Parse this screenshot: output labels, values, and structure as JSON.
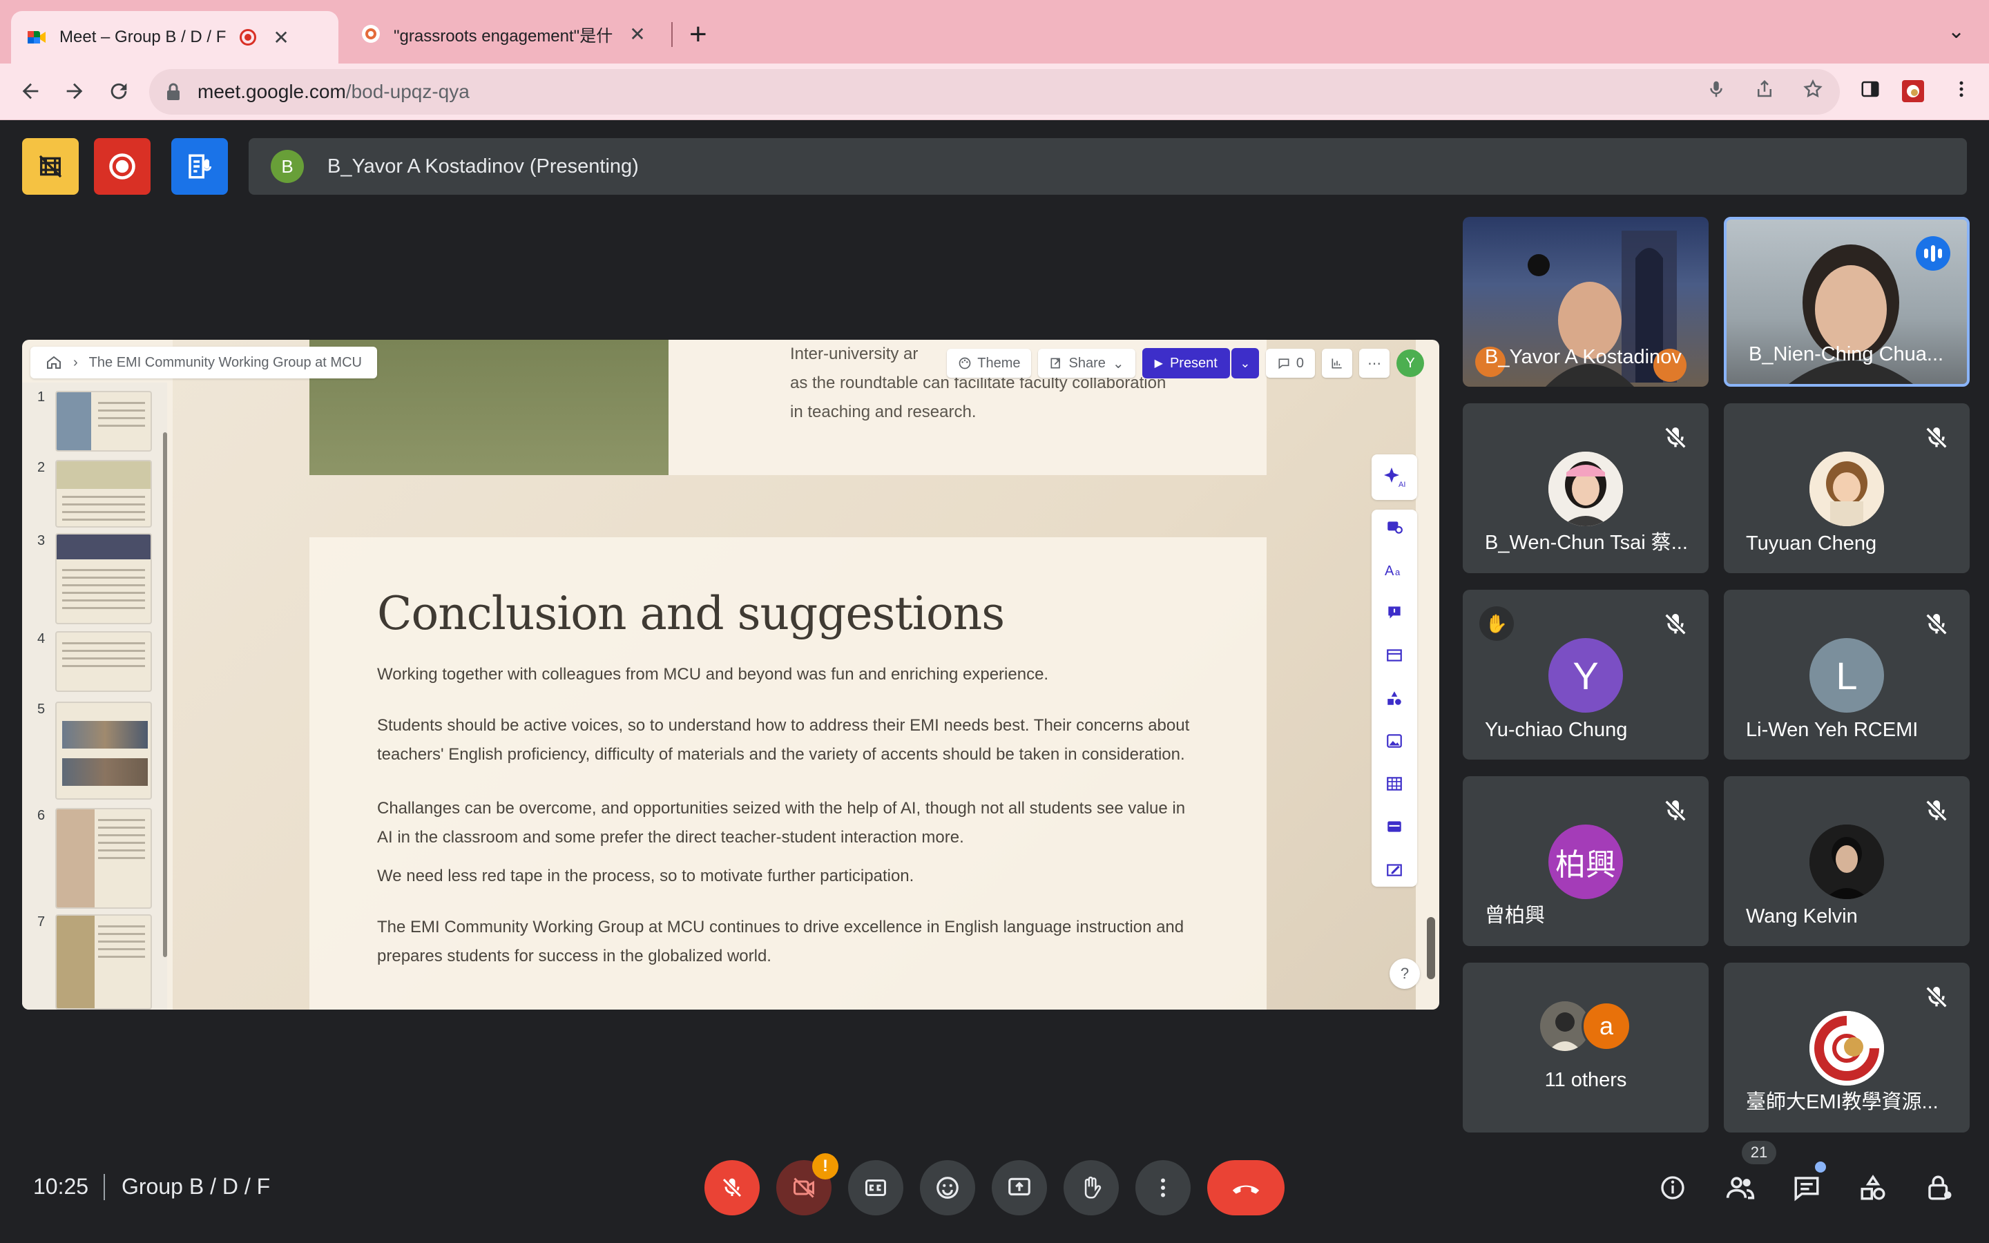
{
  "browser": {
    "tabs": [
      {
        "title": "Meet – Group B / D / F",
        "recording": true
      },
      {
        "title": "\"grassroots engagement\"是什"
      }
    ],
    "url_host": "meet.google.com",
    "url_path": "/bod-upqz-qya"
  },
  "meet": {
    "presenter_initial": "B",
    "presenting_label": "B_Yavor A Kostadinov (Presenting)",
    "time": "10:25",
    "meeting_name": "Group B / D / F",
    "people_count": "21",
    "warning_badge": "!"
  },
  "slides_editor": {
    "breadcrumb_title": "The EMI Community Working Group at MCU",
    "theme_label": "Theme",
    "share_label": "Share",
    "present_label": "Present",
    "comment_count": "0",
    "user_initial": "Y",
    "ai_label": "AI",
    "help_label": "?",
    "thumbnail_numbers": [
      "1",
      "2",
      "3",
      "4",
      "5",
      "6",
      "7"
    ]
  },
  "slide": {
    "top_text": "Inter-university ar… as the roundtable can facilitate faculty collaboration in teaching and research.",
    "top_line1": "Inter-university ar",
    "top_line2": "as the roundtable can facilitate faculty collaboration",
    "top_line3": "in teaching and research.",
    "title": "Conclusion and suggestions",
    "paragraphs": [
      "Working together with colleagues from MCU and beyond was fun and enriching experience.",
      "Students should be active voices, so to understand how to address their EMI needs best. Their concerns about teachers' English proficiency, difficulty of materials and the variety of accents should be taken in consideration.",
      "Challanges can be overcome, and opportunities seized with the help of AI, though not all students see value in AI in the classroom and some prefer the direct teacher-student interaction more.",
      "We need less red tape in the process, so to motivate further participation.",
      "The EMI Community Working Group at MCU continues to drive excellence in English language instruction and prepares students for success in the globalized world."
    ]
  },
  "participants": [
    {
      "name": "B_Yavor A Kostadinov",
      "kind": "video"
    },
    {
      "name": "B_Nien-Ching Chua...",
      "kind": "video",
      "speaking": true
    },
    {
      "name": "B_Wen-Chun Tsai 蔡...",
      "kind": "photo",
      "muted": true
    },
    {
      "name": "Tuyuan Cheng",
      "kind": "photo",
      "muted": true
    },
    {
      "name": "Yu-chiao Chung",
      "initial": "Y",
      "color": "#7b4fc4",
      "muted": true,
      "hand_raised": true
    },
    {
      "name": "Li-Wen Yeh RCEMI",
      "initial": "L",
      "color": "#7b8f9c",
      "muted": true
    },
    {
      "name": "曾柏興",
      "initial": "柏興",
      "color": "#a43cb8",
      "muted": true
    },
    {
      "name": "Wang Kelvin",
      "kind": "photo",
      "muted": true
    },
    {
      "name": "11 others",
      "initial": "a",
      "color": "#e8710a"
    },
    {
      "name": "臺師大EMI教學資源...",
      "kind": "logo",
      "muted": true
    }
  ],
  "colors": {
    "present_button": "#3d2ec9",
    "hangup": "#ea4335",
    "speaking_indicator": "#1a73e8"
  }
}
